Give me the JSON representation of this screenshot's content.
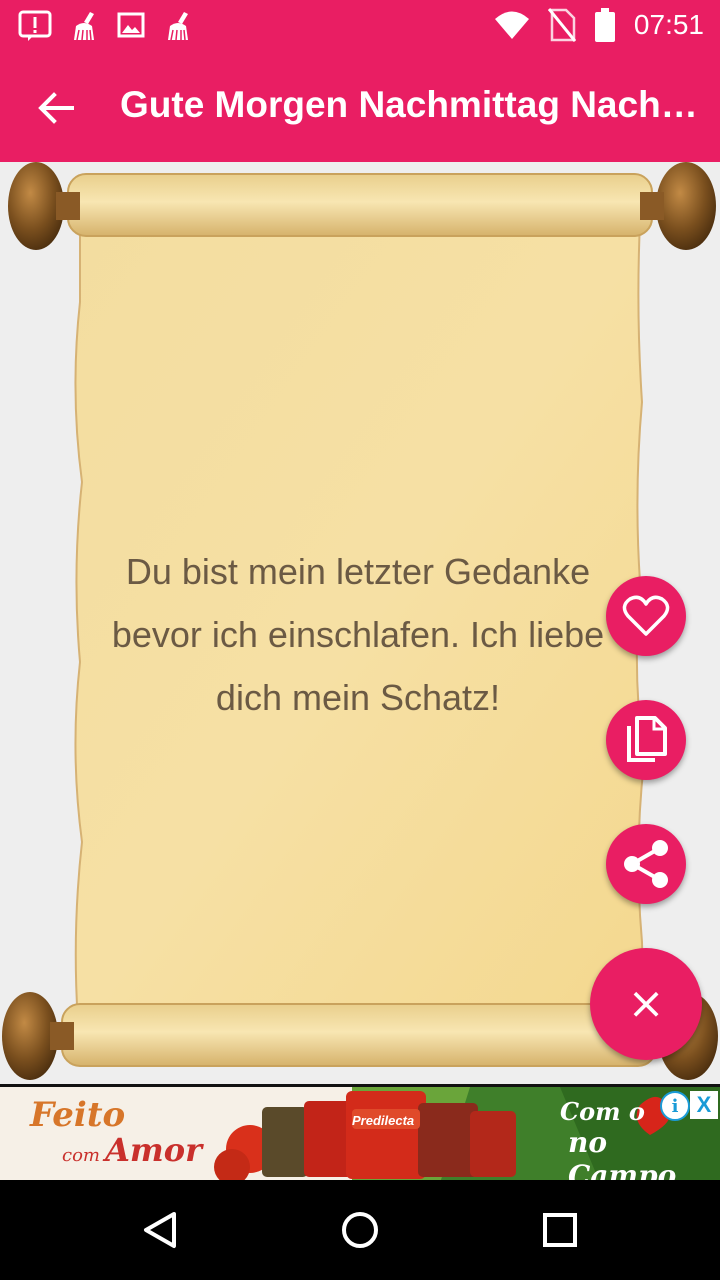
{
  "status_bar": {
    "time": "07:51",
    "left_icons": [
      "alert-icon",
      "cleaner-icon",
      "image-icon",
      "cleaner-icon"
    ],
    "right_icons": [
      "wifi-icon",
      "no-sim-icon",
      "battery-icon"
    ]
  },
  "app_bar": {
    "title": "Gute Morgen Nachmittag Nachricht",
    "back_icon": "arrow-back-icon",
    "color": "#e91e63"
  },
  "message": {
    "text": "Du bist mein letzter Gedanke bevor ich einschlafen. Ich liebe dich mein Schatz!"
  },
  "fab_actions": [
    {
      "name": "favorite",
      "icon": "heart-outline-icon"
    },
    {
      "name": "copy",
      "icon": "copy-icon"
    },
    {
      "name": "share",
      "icon": "share-icon"
    }
  ],
  "fab_main": {
    "icon": "close-icon",
    "label": "×"
  },
  "ad": {
    "left_text_1": "Feito",
    "left_text_2": "com",
    "left_text_3": "Amor",
    "brand": "Predilecta",
    "right_text_1": "Com o",
    "right_text_2": "no Campo",
    "info_label": "i",
    "close_label": "X"
  },
  "nav_bar": {
    "icons": [
      "back-triangle-icon",
      "home-circle-icon",
      "recents-square-icon"
    ]
  }
}
